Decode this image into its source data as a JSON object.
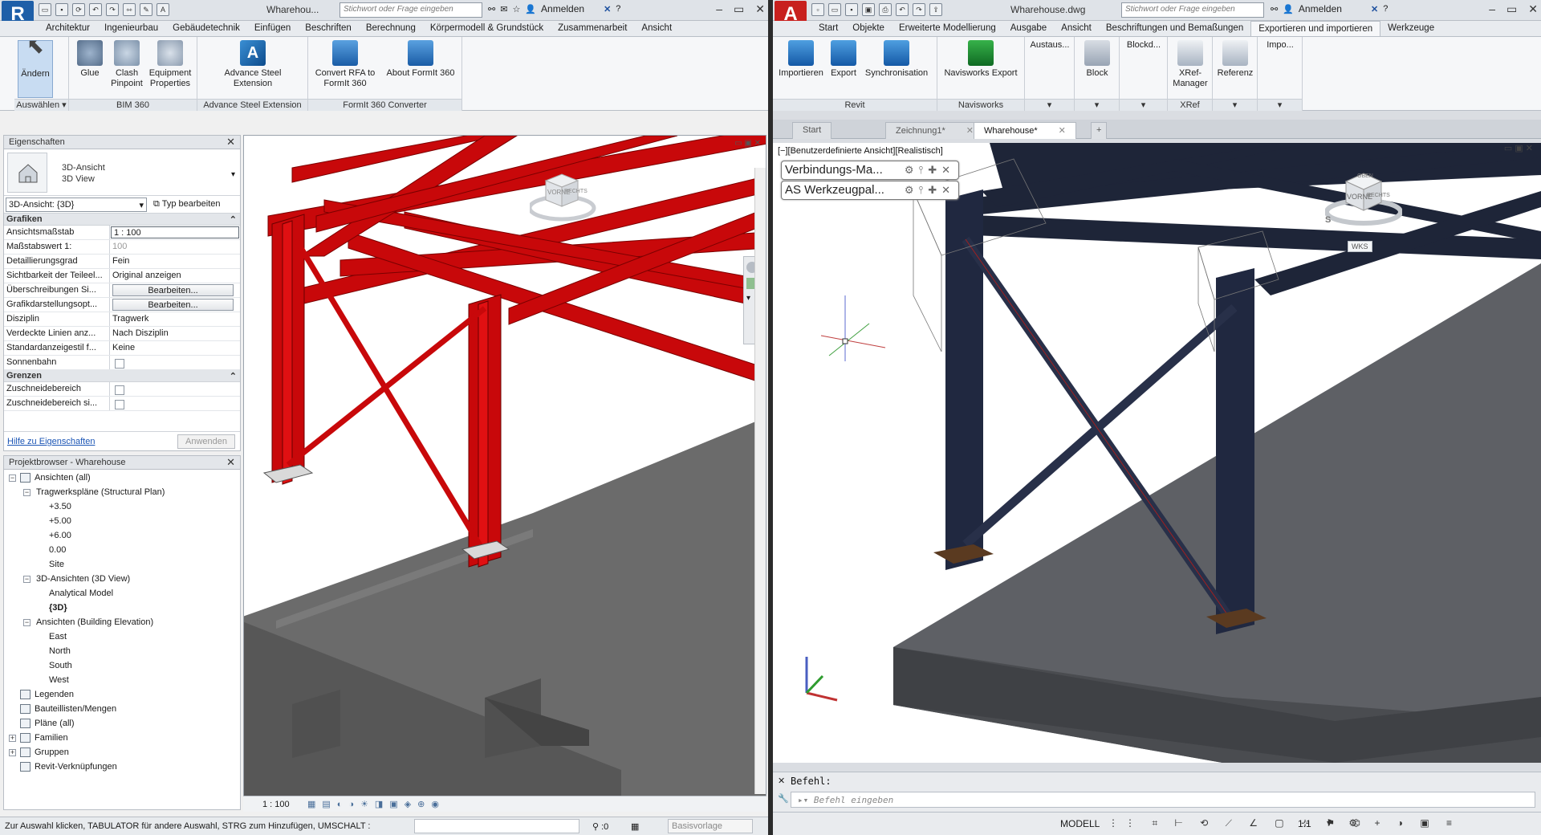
{
  "revit": {
    "app_letter": "R",
    "doc_title": "Wharehou...",
    "search_placeholder": "Stichwort oder Frage eingeben",
    "login": "Anmelden",
    "tabs": [
      "Architektur",
      "Ingenieurbau",
      "Gebäudetechnik",
      "Einfügen",
      "Beschriften",
      "Berechnung",
      "Körpermodell & Grundstück",
      "Zusammenarbeit",
      "Ansicht"
    ],
    "ribbon": {
      "modify": "Ändern",
      "select_panel": "Auswählen",
      "glue": "Glue",
      "clash": "Clash Pinpoint",
      "equipment": "Equipment Properties",
      "bim_panel": "BIM 360",
      "advance_steel": "Advance Steel Extension",
      "advance_panel": "Advance Steel Extension",
      "convert_rfa": "Convert RFA to FormIt 360",
      "about_formit": "About FormIt 360",
      "formit_panel": "FormIt 360 Converter"
    },
    "props": {
      "title": "Eigenschaften",
      "type_line1": "3D-Ansicht",
      "type_line2": "3D View",
      "instance_selector": "3D-Ansicht: {3D}",
      "edit_type": "Typ bearbeiten",
      "group_graphics": "Grafiken",
      "group_bounds": "Grenzen",
      "rows": [
        {
          "name": "Ansichtsmaßstab",
          "value": "1 : 100"
        },
        {
          "name": "Maßstabswert 1:",
          "value": "100"
        },
        {
          "name": "Detaillierungsgrad",
          "value": "Fein"
        },
        {
          "name": "Sichtbarkeit der Teileel...",
          "value": "Original anzeigen"
        },
        {
          "name": "Überschreibungen Si...",
          "value": "Bearbeiten..."
        },
        {
          "name": "Grafikdarstellungsopt...",
          "value": "Bearbeiten..."
        },
        {
          "name": "Disziplin",
          "value": "Tragwerk"
        },
        {
          "name": "Verdeckte Linien anz...",
          "value": "Nach Disziplin"
        },
        {
          "name": "Standardanzeigestil f...",
          "value": "Keine"
        },
        {
          "name": "Sonnenbahn",
          "value": ""
        }
      ],
      "bounds_rows": [
        {
          "name": "Zuschneidebereich",
          "value": ""
        },
        {
          "name": "Zuschneidebereich si...",
          "value": ""
        }
      ],
      "help_link": "Hilfe zu Eigenschaften",
      "apply": "Anwenden"
    },
    "browser": {
      "title": "Projektbrowser - Wharehouse",
      "items": [
        {
          "label": "Ansichten (all)",
          "level": 0,
          "toggle": "−"
        },
        {
          "label": "Tragwerkspläne (Structural Plan)",
          "level": 1,
          "toggle": "−"
        },
        {
          "label": "+3.50",
          "level": 2,
          "toggle": ""
        },
        {
          "label": "+5.00",
          "level": 2,
          "toggle": ""
        },
        {
          "label": "+6.00",
          "level": 2,
          "toggle": ""
        },
        {
          "label": "0.00",
          "level": 2,
          "toggle": ""
        },
        {
          "label": "Site",
          "level": 2,
          "toggle": ""
        },
        {
          "label": "3D-Ansichten (3D View)",
          "level": 1,
          "toggle": "−"
        },
        {
          "label": "Analytical Model",
          "level": 2,
          "toggle": ""
        },
        {
          "label": "{3D}",
          "level": 2,
          "toggle": ""
        },
        {
          "label": "Ansichten (Building Elevation)",
          "level": 1,
          "toggle": "−"
        },
        {
          "label": "East",
          "level": 2,
          "toggle": ""
        },
        {
          "label": "North",
          "level": 2,
          "toggle": ""
        },
        {
          "label": "South",
          "level": 2,
          "toggle": ""
        },
        {
          "label": "West",
          "level": 2,
          "toggle": ""
        },
        {
          "label": "Legenden",
          "level": 0,
          "toggle": ""
        },
        {
          "label": "Bauteillisten/Mengen",
          "level": 0,
          "toggle": ""
        },
        {
          "label": "Pläne (all)",
          "level": 0,
          "toggle": ""
        },
        {
          "label": "Familien",
          "level": 0,
          "toggle": "+"
        },
        {
          "label": "Gruppen",
          "level": 0,
          "toggle": "+"
        },
        {
          "label": "Revit-Verknüpfungen",
          "level": 0,
          "toggle": ""
        }
      ]
    },
    "view_scale": "1 : 100",
    "status_text": "Zur Auswahl klicken, TABULATOR für andere Auswahl, STRG zum Hinzufügen, UMSCHALT :",
    "status_count": ":0",
    "status_template": "Basisvorlage",
    "viewcube_front": "VORNE",
    "viewcube_right": "RECHTS",
    "colors": {
      "steel": "#c8080a",
      "concrete": "#6b6b6b"
    }
  },
  "acad": {
    "app_letter": "A",
    "doc_title": "Wharehouse.dwg",
    "search_placeholder": "Stichwort oder Frage eingeben",
    "login": "Anmelden",
    "tabs": [
      "Start",
      "Objekte",
      "Erweiterte Modellierung",
      "Ausgabe",
      "Ansicht",
      "Beschriftungen und Bemaßungen",
      "Exportieren und importieren",
      "Werkzeuge"
    ],
    "active_tab": "Exportieren und importieren",
    "ribbon": {
      "import": "Importieren",
      "export": "Export",
      "sync": "Synchronisation",
      "revit_panel": "Revit",
      "navis_export": "Navisworks Export",
      "navis_panel": "Navisworks",
      "austausch": "Austaus...",
      "block": "Block",
      "blockd": "Blockd...",
      "xref_mgr": "XRef-Manager",
      "xref_panel": "XRef",
      "referenz": "Referenz",
      "impo": "Impo..."
    },
    "file_tabs": [
      "Start",
      "Zeichnung1*",
      "Wharehouse*"
    ],
    "viewport_label": "[−][Benutzerdefinierte Ansicht][Realistisch]",
    "palettes": [
      "Verbindungs-Ma...",
      "AS Werkzeugpal..."
    ],
    "viewcube_top": "OBEN",
    "viewcube_front": "VORNE",
    "viewcube_right": "RECHTS",
    "compass_s": "S",
    "wcs": "WKS",
    "cmd_history": "Befehl:",
    "cmd_placeholder": "Befehl eingeben",
    "model_tab": "MODELL",
    "scale": "1:1",
    "colors": {
      "steel": "#1e2538",
      "concrete": "#5e6065"
    }
  }
}
